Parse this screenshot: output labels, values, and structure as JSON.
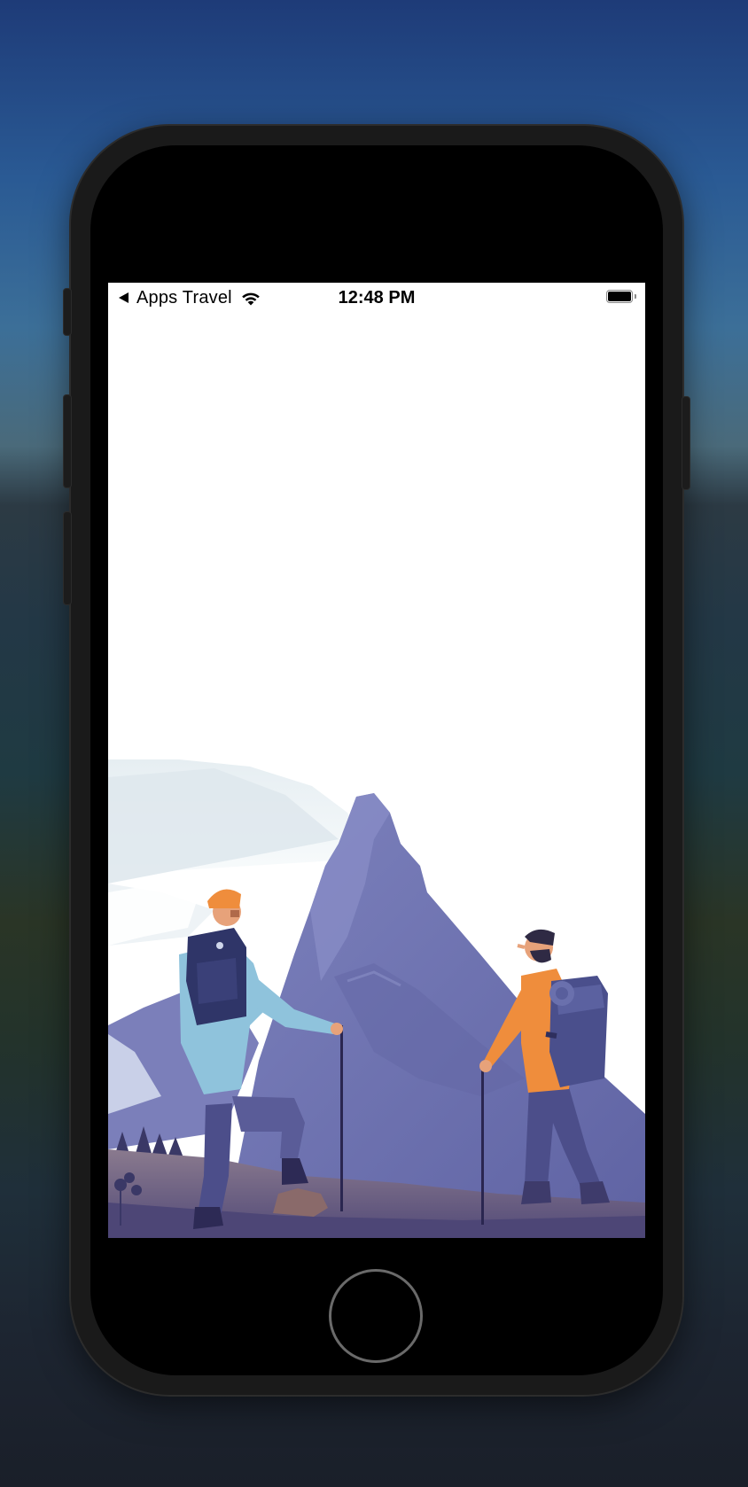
{
  "status_bar": {
    "back_app_label": "Apps Travel",
    "time": "12:48 PM",
    "battery_level": 1.0
  },
  "icons": {
    "back": "back-arrow-icon",
    "wifi": "wifi-icon",
    "battery": "battery-icon"
  },
  "screen": {
    "background": "#ffffff",
    "illustration": "hikers-mountain-illustration"
  },
  "colors": {
    "mountain": "#6f74b0",
    "ground": "#5b5680",
    "jacket_blue": "#8fc3dc",
    "jacket_orange": "#ef8d3c"
  }
}
